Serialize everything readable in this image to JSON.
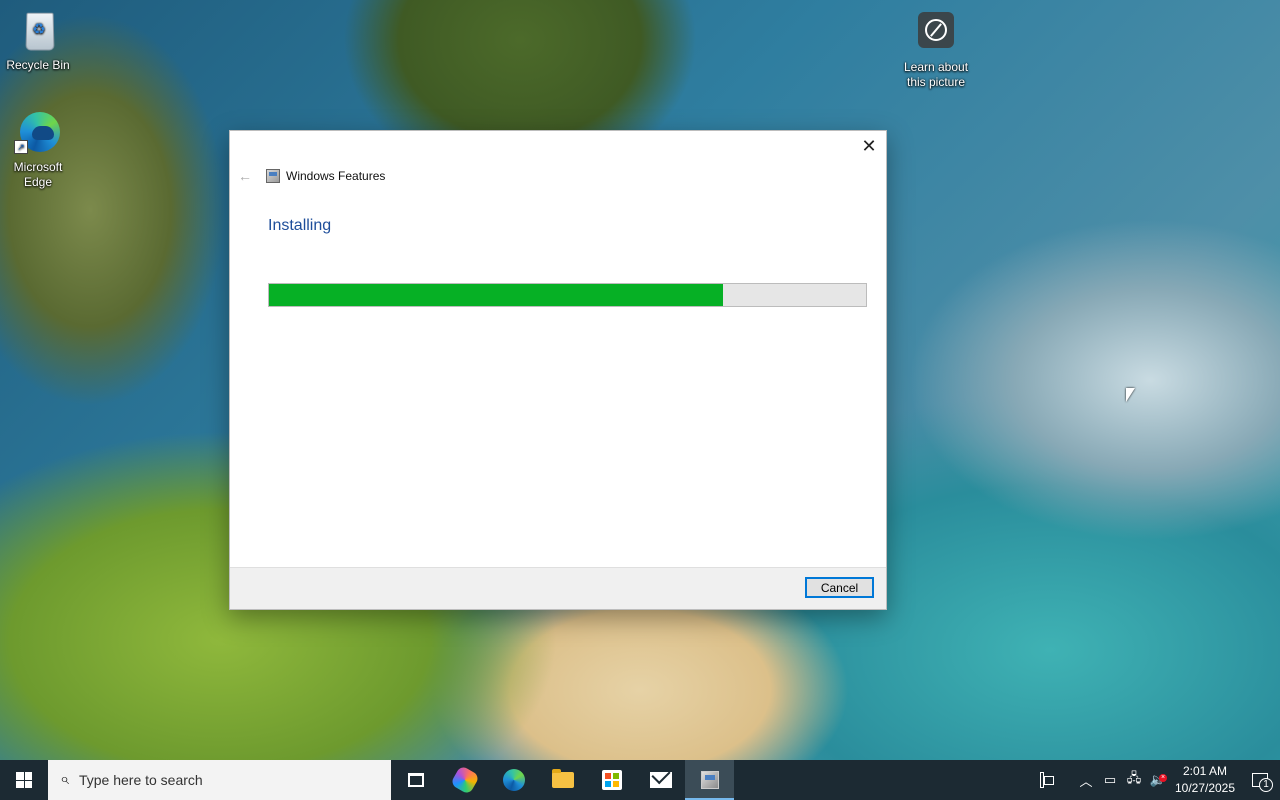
{
  "desktop": {
    "icons": [
      {
        "label": "Recycle Bin",
        "icon": "recycle-bin-icon"
      },
      {
        "label": "Microsoft Edge",
        "icon": "edge-icon"
      },
      {
        "label": "Learn about this picture",
        "icon": "camera-icon"
      }
    ]
  },
  "dialog": {
    "title": "Windows Features",
    "heading": "Installing",
    "progress_percent": 76,
    "progress_color": "#06b025",
    "cancel_label": "Cancel",
    "close_glyph": "✕",
    "back_glyph": "←"
  },
  "taskbar": {
    "search_placeholder": "Type here to search",
    "apps": [
      "task-view",
      "copilot",
      "microsoft-edge",
      "file-explorer",
      "microsoft-store",
      "mail",
      "windows-features"
    ],
    "clock": {
      "time": "2:01 AM",
      "date": "10/27/2025"
    },
    "notification_count": "1",
    "accent": "#76b9ed"
  }
}
